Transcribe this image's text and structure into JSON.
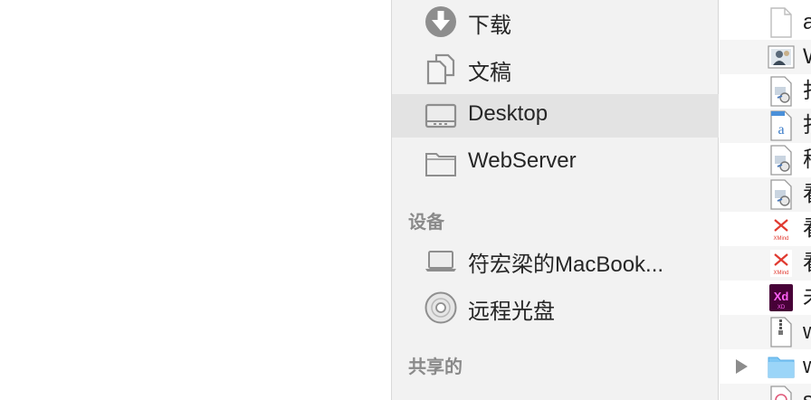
{
  "sidebar": {
    "favorites": [
      {
        "label": "下载",
        "icon": "download-icon"
      },
      {
        "label": "文稿",
        "icon": "documents-icon"
      },
      {
        "label": "Desktop",
        "icon": "desktop-icon",
        "selected": true
      },
      {
        "label": "WebServer",
        "icon": "folder-icon"
      }
    ],
    "devices_title": "设备",
    "devices": [
      {
        "label": "符宏梁的MacBook...",
        "icon": "laptop-icon"
      },
      {
        "label": "远程光盘",
        "icon": "disc-icon"
      }
    ],
    "shared_title": "共享的"
  },
  "files": [
    {
      "name": "a",
      "icon": "blank-document-icon"
    },
    {
      "name": "W",
      "icon": "image-file-icon"
    },
    {
      "name": "打",
      "icon": "preview-document-icon"
    },
    {
      "name": "打",
      "icon": "text-document-icon"
    },
    {
      "name": "稻",
      "icon": "preview-document-icon"
    },
    {
      "name": "看",
      "icon": "preview-document-icon"
    },
    {
      "name": "看",
      "icon": "xmind-file-icon"
    },
    {
      "name": "看",
      "icon": "xmind-file-icon"
    },
    {
      "name": "未",
      "icon": "adobe-xd-file-icon"
    },
    {
      "name": "w",
      "icon": "zip-archive-icon"
    },
    {
      "name": "w",
      "icon": "blue-folder-icon"
    },
    {
      "name": "s",
      "icon": "partial-file-icon"
    }
  ],
  "colors": {
    "sidebar_bg": "#f2f2f2",
    "selected_bg": "#e3e3e3",
    "icon_gray": "#8e8e8e",
    "folder_blue": "#7fc7f4",
    "xmind_red": "#e0392f",
    "xd_purple": "#470137"
  }
}
